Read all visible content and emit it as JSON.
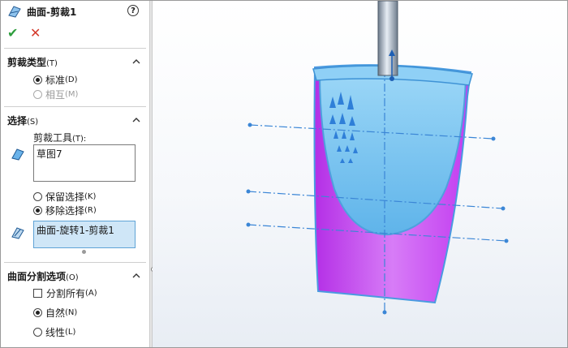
{
  "header": {
    "title": "曲面-剪裁1",
    "help": "?",
    "ok": "✔",
    "cancel": "✕"
  },
  "trim_type": {
    "title": "剪裁类型",
    "shortcut": "(T)",
    "options": [
      {
        "label": "标准",
        "shortcut": "(D)",
        "selected": true,
        "enabled": true
      },
      {
        "label": "相互",
        "shortcut": "(M)",
        "selected": false,
        "enabled": false
      }
    ]
  },
  "selections": {
    "title": "选择",
    "shortcut": "(S)",
    "tool_label": "剪裁工具",
    "tool_shortcut": "(T):",
    "tool_value": "草图7",
    "options": [
      {
        "label": "保留选择",
        "shortcut": "(K)",
        "selected": false
      },
      {
        "label": "移除选择",
        "shortcut": "(R)",
        "selected": true
      }
    ],
    "pieces_value": "曲面-旋转1-剪裁1"
  },
  "split_options": {
    "title": "曲面分割选项",
    "shortcut": "(O)",
    "split_all": {
      "label": "分割所有",
      "shortcut": "(A)",
      "checked": false
    },
    "options": [
      {
        "label": "自然",
        "shortcut": "(N)",
        "selected": true
      },
      {
        "label": "线性",
        "shortcut": "(L)",
        "selected": false
      }
    ]
  },
  "colors": {
    "accent": "#2f7fd8",
    "surface_magenta": "#c23bf0",
    "surface_blue": "#7fc6f2",
    "ok": "#2e9e3e",
    "cancel": "#d43a2c"
  }
}
